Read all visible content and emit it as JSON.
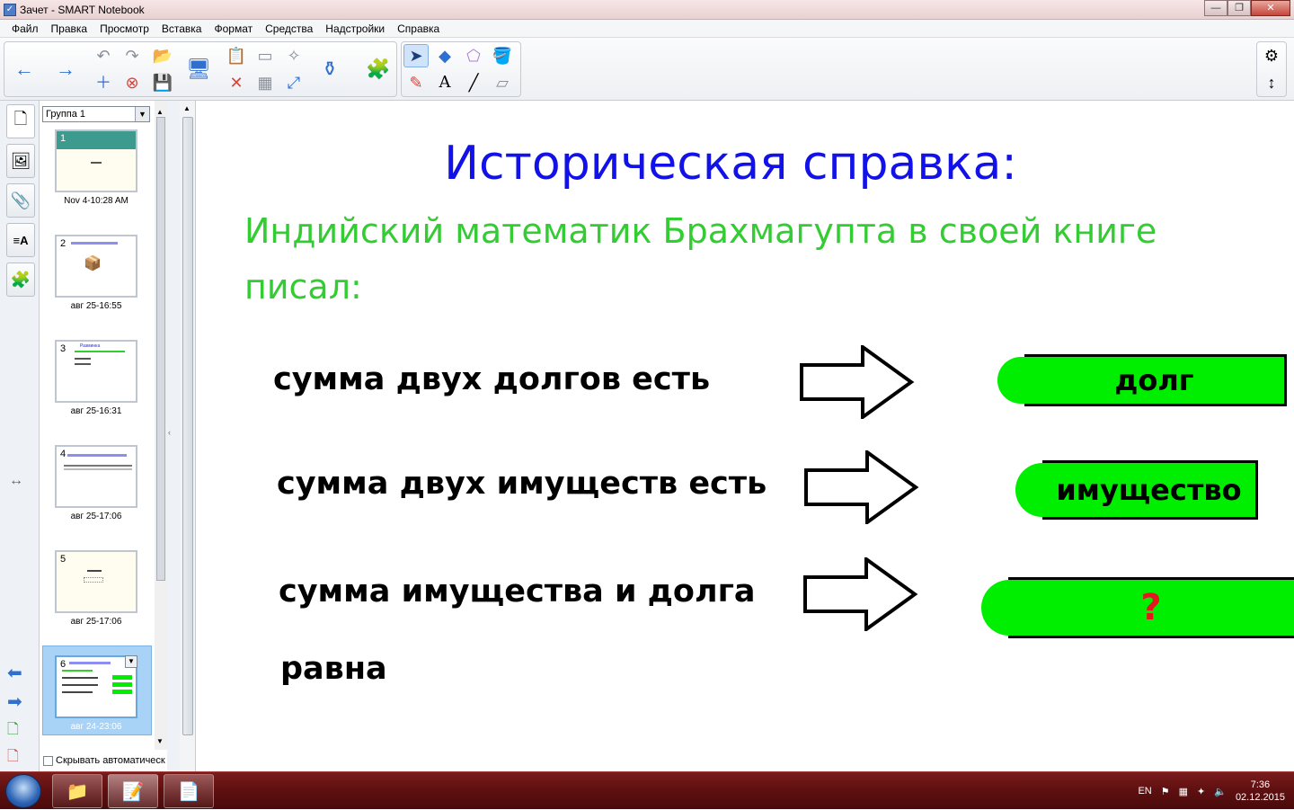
{
  "window": {
    "title": "Зачет - SMART Notebook",
    "minimize": "—",
    "restore": "❐",
    "close": "✕"
  },
  "menu": [
    "Файл",
    "Правка",
    "Просмотр",
    "Вставка",
    "Формат",
    "Средства",
    "Надстройки",
    "Справка"
  ],
  "toolbar": {
    "back_icon": "←",
    "forward_icon": "→",
    "undo_icon": "↶",
    "redo_icon": "↷",
    "open_icon": "📂",
    "save_icon": "💾",
    "display_icon": "🖥",
    "paste_icon": "📋",
    "delete_icon": "✕",
    "screen_shade_icon": "▭",
    "table_icon": "▦",
    "fullscreen_icon": "⤢",
    "capture_icon": "✧",
    "ink_icon": "⚱",
    "addons_icon": "🧩",
    "select_icon": "➤",
    "shapes_icon": "◆",
    "eraser_shape_icon": "⬠",
    "fill_icon": "🪣",
    "pens_icon": "✎",
    "text_icon": "A",
    "line_icon": "╱",
    "eraser_icon": "▱",
    "settings_icon": "⚙",
    "move_toolbar_icon": "↕"
  },
  "sidebar_tabs": [
    "page-sorter",
    "gallery",
    "attachments",
    "properties",
    "addons"
  ],
  "sorter": {
    "group": "Группа 1",
    "autohide_label": "Скрывать автоматическ",
    "pages": [
      {
        "num": "1",
        "caption": "Nov 4-10:28 AM"
      },
      {
        "num": "2",
        "caption": "авг 25-16:55"
      },
      {
        "num": "3",
        "caption": "авг 25-16:31"
      },
      {
        "num": "4",
        "caption": "авг 25-17:06"
      },
      {
        "num": "5",
        "caption": "авг 25-17:06"
      },
      {
        "num": "6",
        "caption": "авг 24-23:06"
      }
    ],
    "thumb3_label": "Разминка"
  },
  "slide": {
    "title": "Историческая справка:",
    "intro": "Индийский математик Брахмагупта в своей книге писал:",
    "statements": [
      "сумма двух долгов есть",
      "сумма двух имуществ есть",
      "сумма имущества и долга",
      "равна"
    ],
    "answers": [
      "долг",
      "имущество",
      "?"
    ]
  },
  "taskbar": {
    "lang": "EN",
    "time": "7:36",
    "date": "02.12.2015"
  },
  "colors": {
    "title_blue": "#1111e8",
    "intro_green": "#33cc33",
    "answer_green": "#00ee00",
    "question_red": "#e3171e"
  }
}
